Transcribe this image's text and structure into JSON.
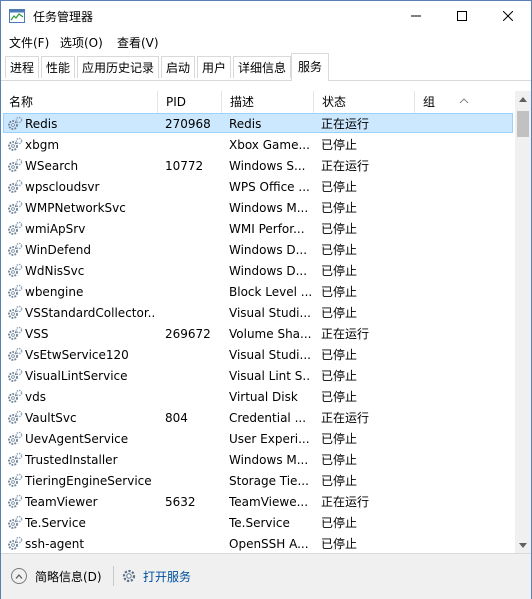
{
  "window": {
    "title": "任务管理器"
  },
  "menu": [
    "文件(F)",
    "选项(O)",
    "查看(V)"
  ],
  "tabs": [
    "进程",
    "性能",
    "应用历史记录",
    "启动",
    "用户",
    "详细信息",
    "服务"
  ],
  "active_tab": "服务",
  "columns": [
    "名称",
    "PID",
    "描述",
    "状态",
    "组"
  ],
  "services": [
    {
      "name": "Redis",
      "pid": "270968",
      "desc": "Redis",
      "status": "正在运行",
      "selected": true
    },
    {
      "name": "xbgm",
      "pid": "",
      "desc": "Xbox Game...",
      "status": "已停止"
    },
    {
      "name": "WSearch",
      "pid": "10772",
      "desc": "Windows S...",
      "status": "正在运行"
    },
    {
      "name": "wpscloudsvr",
      "pid": "",
      "desc": "WPS Office ...",
      "status": "已停止"
    },
    {
      "name": "WMPNetworkSvc",
      "pid": "",
      "desc": "Windows M...",
      "status": "已停止"
    },
    {
      "name": "wmiApSrv",
      "pid": "",
      "desc": "WMI Perfor...",
      "status": "已停止"
    },
    {
      "name": "WinDefend",
      "pid": "",
      "desc": "Windows D...",
      "status": "已停止"
    },
    {
      "name": "WdNisSvc",
      "pid": "",
      "desc": "Windows D...",
      "status": "已停止"
    },
    {
      "name": "wbengine",
      "pid": "",
      "desc": "Block Level ...",
      "status": "已停止"
    },
    {
      "name": "VSStandardCollector...",
      "pid": "",
      "desc": "Visual Studi...",
      "status": "已停止"
    },
    {
      "name": "VSS",
      "pid": "269672",
      "desc": "Volume Sha...",
      "status": "正在运行"
    },
    {
      "name": "VsEtwService120",
      "pid": "",
      "desc": "Visual Studi...",
      "status": "已停止"
    },
    {
      "name": "VisualLintService",
      "pid": "",
      "desc": "Visual Lint S...",
      "status": "已停止"
    },
    {
      "name": "vds",
      "pid": "",
      "desc": "Virtual Disk",
      "status": "已停止"
    },
    {
      "name": "VaultSvc",
      "pid": "804",
      "desc": "Credential ...",
      "status": "正在运行"
    },
    {
      "name": "UevAgentService",
      "pid": "",
      "desc": "User Experi...",
      "status": "已停止"
    },
    {
      "name": "TrustedInstaller",
      "pid": "",
      "desc": "Windows M...",
      "status": "已停止"
    },
    {
      "name": "TieringEngineService",
      "pid": "",
      "desc": "Storage Tie...",
      "status": "已停止"
    },
    {
      "name": "TeamViewer",
      "pid": "5632",
      "desc": "TeamViewe...",
      "status": "正在运行"
    },
    {
      "name": "Te.Service",
      "pid": "",
      "desc": "Te.Service",
      "status": "已停止"
    },
    {
      "name": "ssh-agent",
      "pid": "",
      "desc": "OpenSSH A...",
      "status": "已停止"
    }
  ],
  "footer": {
    "brief_label": "简略信息(D)",
    "open_services_label": "打开服务"
  },
  "colors": {
    "selection_bg": "#cce8ff",
    "selection_border": "#99d1ff",
    "link": "#0050a0"
  },
  "icons": {
    "app": "task-manager-icon",
    "service": "gear-icon",
    "brief": "chevron-up-circle-icon",
    "open": "gear-icon"
  }
}
